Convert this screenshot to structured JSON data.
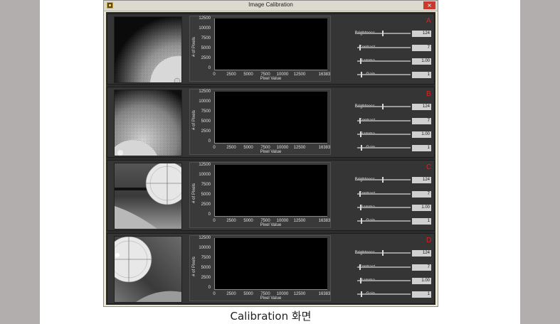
{
  "window": {
    "title": "Image Calibration",
    "close_label": "×"
  },
  "caption": "Calibration 화면",
  "histogram": {
    "yticks": [
      "12500",
      "10000",
      "7500",
      "5000",
      "2500",
      "0"
    ],
    "xticks": [
      "0",
      "2500",
      "5000",
      "7500",
      "10000",
      "12500",
      "16383"
    ],
    "ylabel": "# of Pixels",
    "xlabel": "Pixel Value"
  },
  "controls": {
    "brightness_label": "Brightness",
    "contrast_label": "Contrast",
    "gamma_label": "Gamma",
    "gain_label": "Gain"
  },
  "panels": [
    {
      "letter": "A",
      "brightness": "124",
      "contrast": "7",
      "gamma": "1.00",
      "gain": "1"
    },
    {
      "letter": "B",
      "brightness": "124",
      "contrast": "7",
      "gamma": "1.00",
      "gain": "1"
    },
    {
      "letter": "C",
      "brightness": "124",
      "contrast": "7",
      "gamma": "1.00",
      "gain": "1"
    },
    {
      "letter": "D",
      "brightness": "124",
      "contrast": "7",
      "gamma": "1.00",
      "gain": "1"
    }
  ],
  "colors": {
    "letter": "#e0201e",
    "panel_bg": "#353535",
    "plot_bg": "#000000"
  }
}
